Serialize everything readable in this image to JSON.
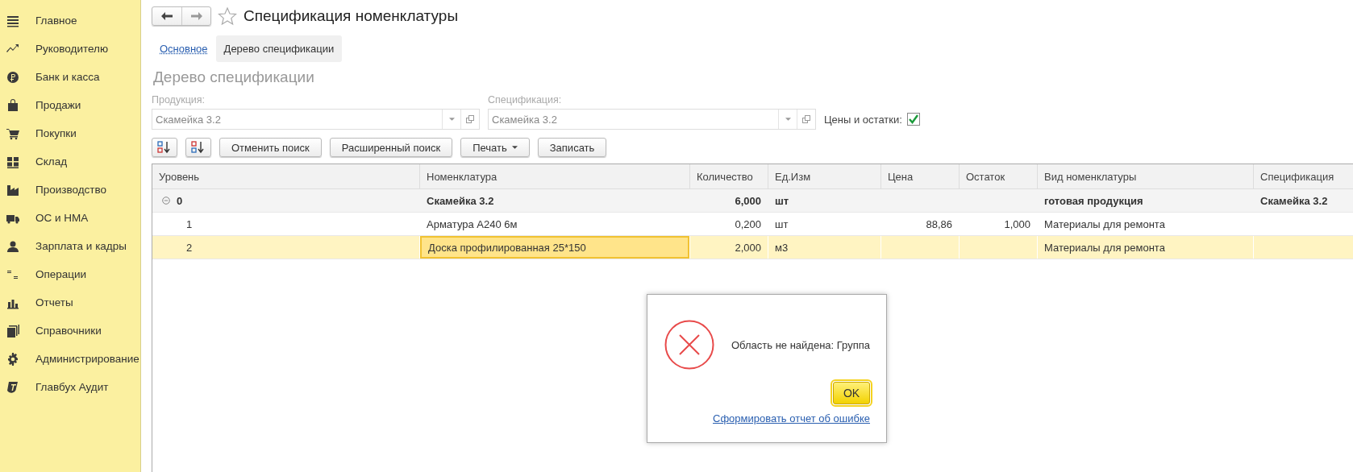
{
  "sidebar": {
    "items": [
      {
        "label": "Главное"
      },
      {
        "label": "Руководителю"
      },
      {
        "label": "Банк и касса"
      },
      {
        "label": "Продажи"
      },
      {
        "label": "Покупки"
      },
      {
        "label": "Склад"
      },
      {
        "label": "Производство"
      },
      {
        "label": "ОС и НМА"
      },
      {
        "label": "Зарплата и кадры"
      },
      {
        "label": "Операции"
      },
      {
        "label": "Отчеты"
      },
      {
        "label": "Справочники"
      },
      {
        "label": "Администрирование"
      },
      {
        "label": "Главбух Аудит"
      }
    ]
  },
  "window": {
    "title": "Спецификация номенклатуры"
  },
  "tabs": [
    {
      "label": "Основное",
      "selected": false
    },
    {
      "label": "Дерево спецификации",
      "selected": true
    }
  ],
  "section_title": "Дерево спецификации",
  "fields": [
    {
      "label": "Продукция:",
      "value": "Скамейка 3.2"
    },
    {
      "label": "Спецификация:",
      "value": "Скамейка 3.2"
    }
  ],
  "prices_checkbox": {
    "label": "Цены и остатки:",
    "checked": true
  },
  "toolbar": {
    "buttons": [
      {
        "label": "Отменить поиск",
        "kind": "plain"
      },
      {
        "label": "Расширенный поиск",
        "kind": "plain"
      },
      {
        "label": "Печать",
        "kind": "menu"
      },
      {
        "label": "Записать",
        "kind": "plain"
      }
    ]
  },
  "table": {
    "columns": [
      "Уровень",
      "Номенклатура",
      "Количество",
      "Ед.Изм",
      "Цена",
      "Остаток",
      "Вид номенклатуры",
      "Спецификация"
    ],
    "rows": [
      {
        "level": "0",
        "name": "Скамейка 3.2",
        "qty": "6,000",
        "unit": "шт",
        "kind_name": "готовая продукция",
        "spec": "Скамейка 3.2",
        "expanded": true,
        "selected": false,
        "children": [
          {
            "level": "1",
            "name": "Арматура А240 6м",
            "qty": "0,200",
            "unit": "шт",
            "price": "88,86",
            "rest": "1,000",
            "kind_name": "Материалы для ремонта",
            "selected": false
          },
          {
            "level": "2",
            "name": "Доска профилированная 25*150",
            "qty": "2,000",
            "unit": "м3",
            "kind_name": "Материалы для ремонта",
            "selected": true
          }
        ]
      }
    ]
  },
  "dialog": {
    "message": "Область не найдена: Группа",
    "ok_button": "OK",
    "report_link": "Сформировать отчет об ошибке"
  }
}
